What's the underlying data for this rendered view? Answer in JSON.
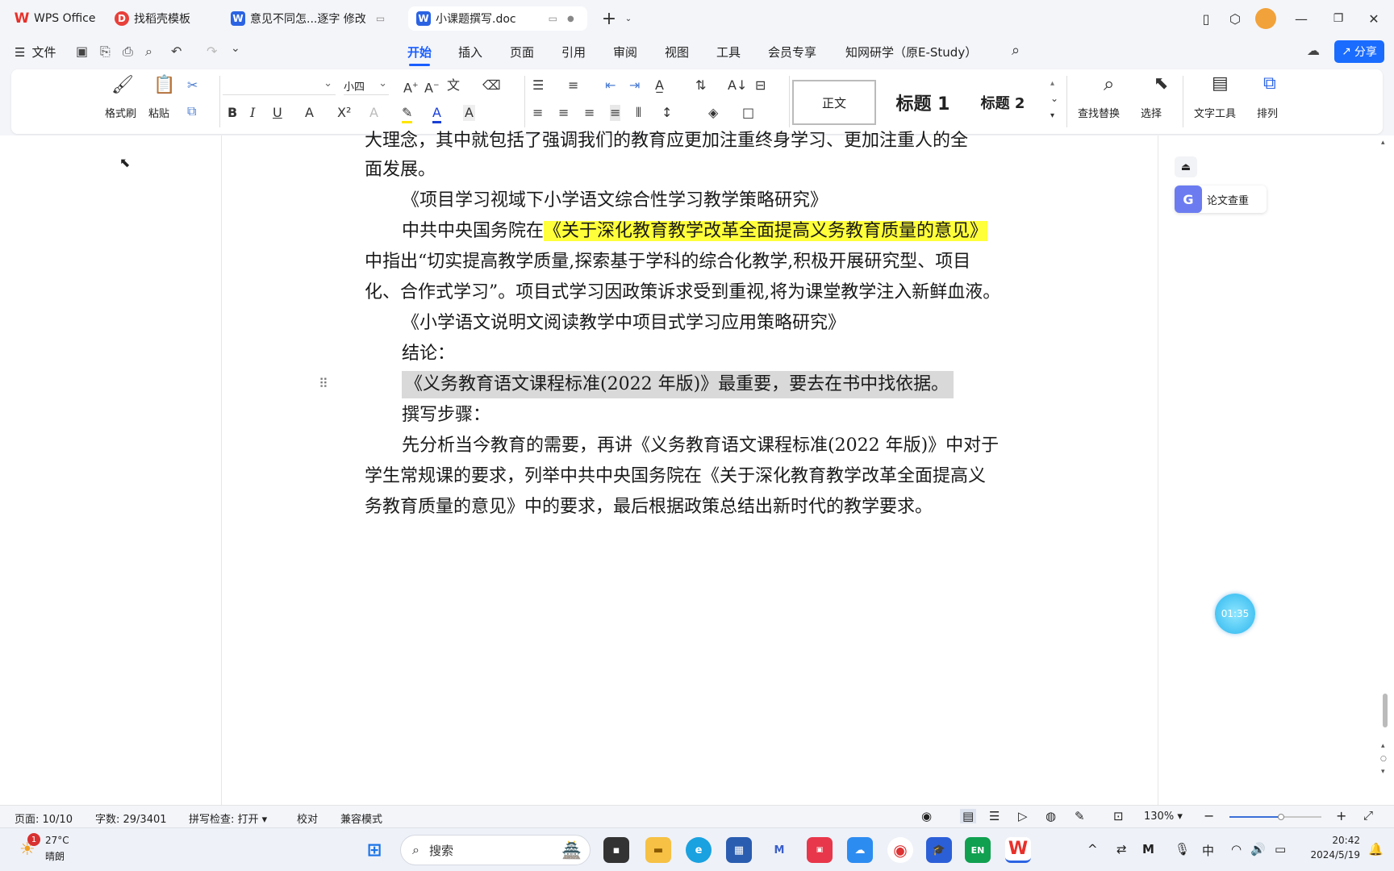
{
  "tabs": [
    {
      "label": "WPS Office",
      "icon": "wps-logo-icon",
      "color": "#e8302a"
    },
    {
      "label": "找稻壳模板",
      "icon": "docer-icon",
      "color": "#e8403a"
    },
    {
      "label": "意见不同怎...逐字 修改",
      "icon": "word-doc-icon",
      "color": "#2b63e3"
    },
    {
      "label": "小课题撰写.doc",
      "icon": "word-doc-icon",
      "color": "#2b63e3"
    }
  ],
  "menu": {
    "file": "文件",
    "items": [
      "开始",
      "插入",
      "页面",
      "引用",
      "审阅",
      "视图",
      "工具",
      "会员专享",
      "知网研学（原E-Study）"
    ],
    "active": "开始",
    "share": "分享"
  },
  "ribbon": {
    "format_painter": "格式刷",
    "paste": "粘贴",
    "font_name": "",
    "font_size": "小四",
    "style_body": "正文",
    "style_h1": "标题 1",
    "style_h2": "标题 2",
    "find_replace": "查找替换",
    "select": "选择",
    "text_tools": "文字工具",
    "arrange": "排列"
  },
  "side_panel": {
    "paper_check": "论文查重"
  },
  "timer": "01:35",
  "document": {
    "lines": [
      "大理念，其中就包括了强调我们的教育应更加注重终身学习、更加注重人的全",
      "面发展。",
      "《项目学习视域下小学语文综合性学习教学策略研究》",
      "中共中央国务院在",
      "《关于深化教育教学改革全面提高义务教育质量的意见》",
      "中指出“切实提高教学质量,探索基于学科的综合化教学,积极开展研究型、项目",
      "化、合作式学习”。项目式学习因政策诉求受到重视,将为课堂教学注入新鲜血液。",
      "《小学语文说明文阅读教学中项目式学习应用策略研究》",
      "结论：",
      "《义务教育语文课程标准(2022 年版)》最重要，要去在书中找依据。",
      "撰写步骤：",
      "先分析当今教育的需要，再讲《义务教育语文课程标准(2022 年版)》中对于",
      "学生常规课的要求，列举中共中央国务院在《关于深化教育教学改革全面提高义",
      "务教育质量的意见》中的要求，最后根据政策总结出新时代的教学要求。"
    ]
  },
  "status": {
    "page": "页面: 10/10",
    "words": "字数: 29/3401",
    "spell": "拼写检查: 打开",
    "proof": "校对",
    "compat": "兼容模式",
    "zoom": "130%"
  },
  "taskbar": {
    "weather_temp": "27°C",
    "weather_desc": "晴朗",
    "weather_badge": "1",
    "search": "搜索",
    "time": "20:42",
    "date": "2024/5/19",
    "ime": "中"
  }
}
